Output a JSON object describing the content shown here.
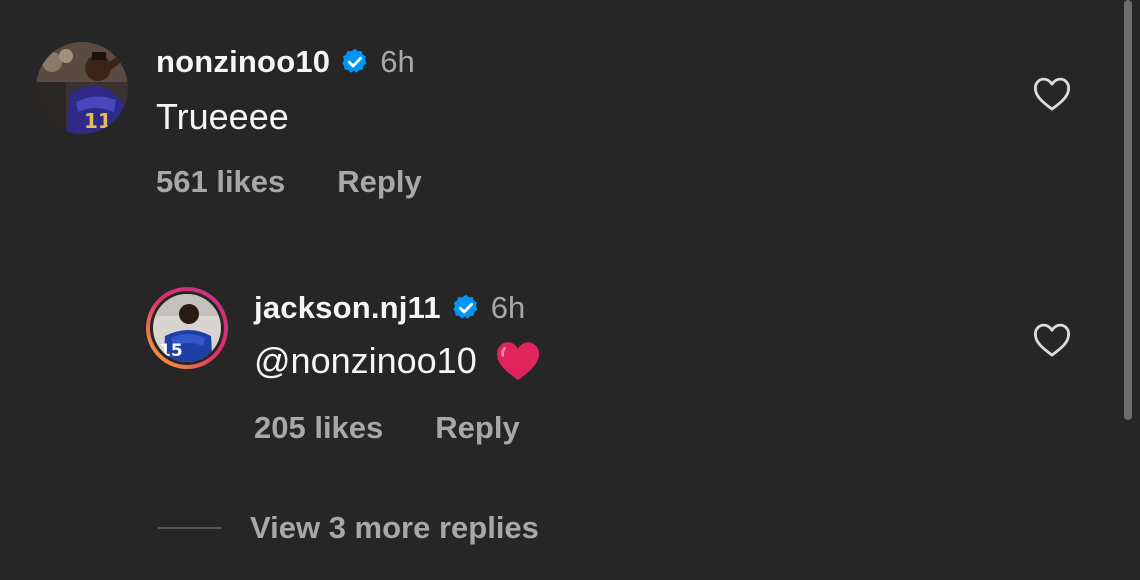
{
  "comments": [
    {
      "username": "nonzinoo10",
      "time": "6h",
      "text": "Trueeee",
      "likes": "561 likes",
      "reply_label": "Reply",
      "verified": true,
      "avatar_icon": "user-avatar-photo",
      "jersey_number": "11"
    },
    {
      "username": "jackson.nj11",
      "time": "6h",
      "text": "@nonzinoo10",
      "emoji": "red-heart-emoji",
      "likes": "205 likes",
      "reply_label": "Reply",
      "verified": true,
      "story_ring": true,
      "avatar_icon": "user-avatar-photo",
      "jersey_number": "15"
    }
  ],
  "view_more_replies": "View 3 more replies",
  "icons": {
    "verified": "verified-badge-icon",
    "like": "heart-outline-icon"
  },
  "colors": {
    "background": "#262626",
    "text_primary": "#f5f5f5",
    "text_secondary": "#a8a8a8",
    "verified_blue": "#0095f6",
    "heart_red": "#e0245e"
  }
}
